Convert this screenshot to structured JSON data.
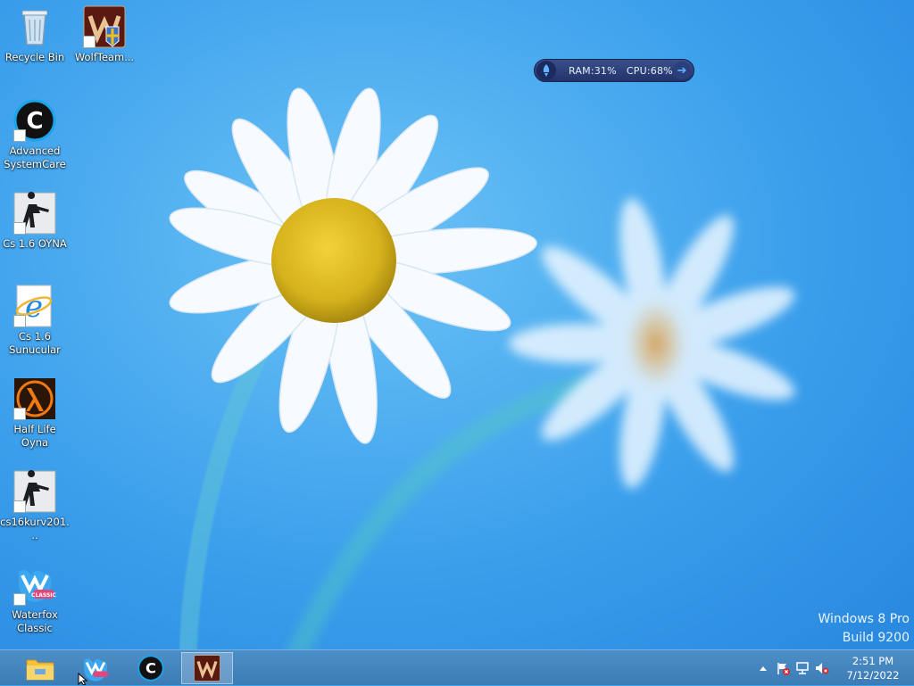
{
  "desktop": {
    "icons": [
      {
        "label": "Recycle Bin",
        "icon": "recycle-bin-icon"
      },
      {
        "label": "WolfTeam...",
        "icon": "wolfteam-icon"
      },
      {
        "label": "Advanced SystemCare",
        "icon": "advanced-systemcare-icon"
      },
      {
        "label": "Cs 1.6 OYNA",
        "icon": "counter-strike-icon"
      },
      {
        "label": "Cs 1.6 Sunucular",
        "icon": "internet-explorer-icon"
      },
      {
        "label": "Half Life Oyna",
        "icon": "half-life-icon"
      },
      {
        "label": "cs16kurv201...",
        "icon": "counter-strike-icon"
      },
      {
        "label": "Waterfox Classic",
        "icon": "waterfox-icon"
      }
    ]
  },
  "gadget": {
    "ram_label": "RAM:",
    "ram_value": "31",
    "cpu_label": "CPU:",
    "cpu_value": "68",
    "unit": "%"
  },
  "watermark": {
    "line1": "Windows 8 Pro",
    "line2": "Build 9200"
  },
  "taskbar": {
    "pinned": [
      "file-explorer-icon",
      "waterfox-icon",
      "advanced-systemcare-icon",
      "wolfteam-icon"
    ],
    "active_index": 3,
    "tray": [
      "show-hidden-icons-chevron",
      "action-center-flag-icon",
      "network-icon",
      "volume-muted-icon"
    ],
    "clock_time": "2:51 PM",
    "clock_date": "7/12/2022"
  },
  "colors": {
    "desktop_blue": "#2e96e6",
    "taskbar_blue": "#4586c0",
    "gadget_navy": "#22336a"
  }
}
